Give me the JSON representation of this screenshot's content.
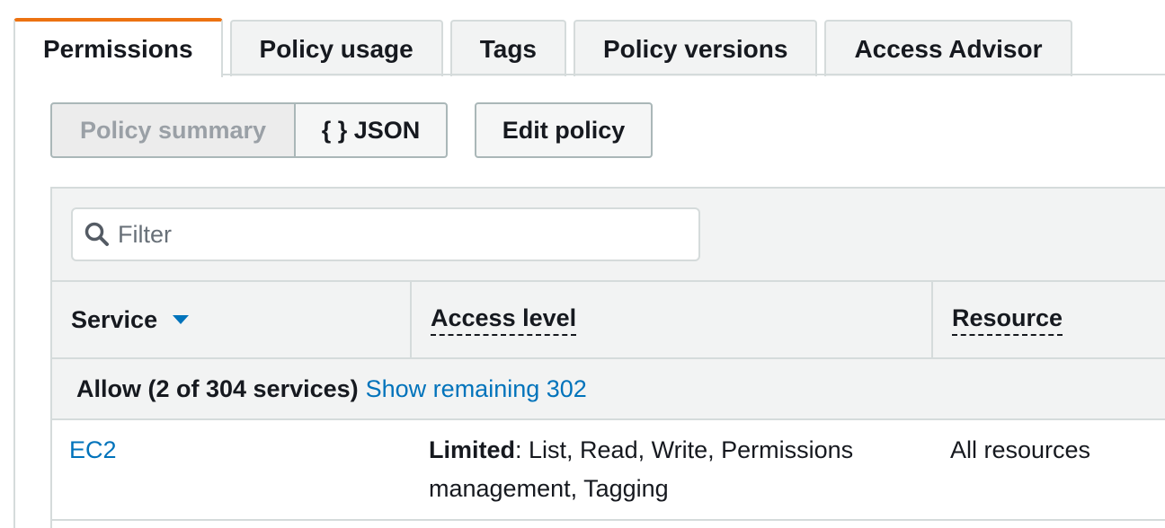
{
  "tabs": [
    {
      "label": "Permissions",
      "active": true
    },
    {
      "label": "Policy usage",
      "active": false
    },
    {
      "label": "Tags",
      "active": false
    },
    {
      "label": "Policy versions",
      "active": false
    },
    {
      "label": "Access Advisor",
      "active": false
    }
  ],
  "toolbar": {
    "policy_summary_label": "Policy summary",
    "json_label": "{ } JSON",
    "edit_policy_label": "Edit policy"
  },
  "filter": {
    "placeholder": "Filter",
    "value": ""
  },
  "table": {
    "columns": {
      "service": "Service",
      "access_level": "Access level",
      "resource": "Resource"
    },
    "allow_group": {
      "label": "Allow (2 of 304 services)",
      "show_remaining": "Show remaining 302"
    },
    "rows": [
      {
        "service": "EC2",
        "access_prefix": "Limited",
        "access_rest": ": List, Read, Write, Permissions management, Tagging",
        "resource": "All resources"
      }
    ]
  },
  "colors": {
    "active_tab_accent": "#ec7211",
    "link": "#0073bb",
    "sort_arrow": "#0073bb"
  },
  "icons": {
    "filter": "search-icon",
    "sort": "caret-down-icon"
  }
}
